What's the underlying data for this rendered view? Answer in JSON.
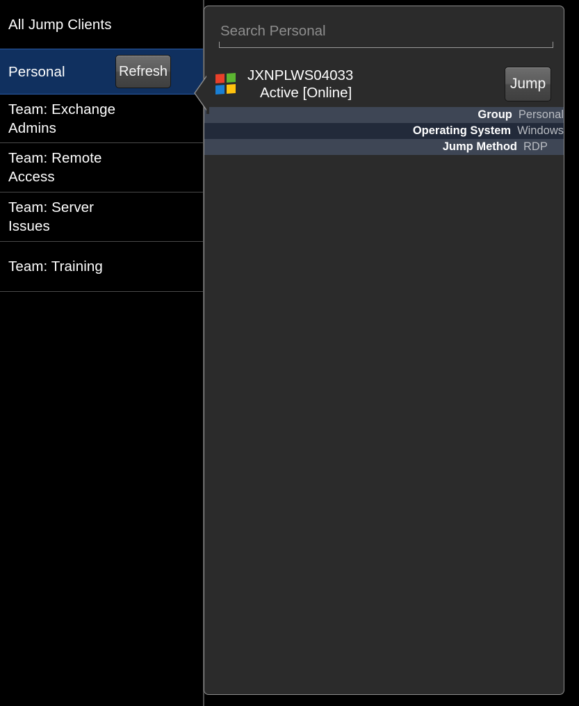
{
  "sidebar": {
    "items": [
      {
        "id": "all-jump-clients",
        "label": "All Jump Clients",
        "selected": false
      },
      {
        "id": "personal",
        "label": "Personal",
        "selected": true
      },
      {
        "id": "team-exchange-admins",
        "label": "Team: Exchange\nAdmins",
        "selected": false
      },
      {
        "id": "team-remote-access",
        "label": "Team: Remote\nAccess",
        "selected": false
      },
      {
        "id": "team-server-issues",
        "label": "Team: Server\nIssues",
        "selected": false
      },
      {
        "id": "team-training",
        "label": "Team: Training",
        "selected": false
      }
    ],
    "refresh_label": "Refresh"
  },
  "panel": {
    "search": {
      "value": "",
      "placeholder": "Search Personal"
    },
    "client": {
      "icon": "windows-logo-icon",
      "name": "JXNPLWS04033",
      "status": "Active [Online]",
      "jump_label": "Jump"
    },
    "attributes": [
      {
        "label": "Group",
        "value": "Personal"
      },
      {
        "label": "Operating System",
        "value": "Windows"
      },
      {
        "label": "Jump Method",
        "value": "RDP"
      }
    ]
  },
  "colors": {
    "background": "#000000",
    "selected_row": "#10305f",
    "panel_background": "#2b2b2b",
    "panel_border": "#8e8e8e",
    "attr_row_odd": "#3e4655",
    "attr_row_even": "#222a3a",
    "text_primary": "#ffffff",
    "text_muted": "#b9bcc2",
    "placeholder": "#8d8d8d"
  }
}
